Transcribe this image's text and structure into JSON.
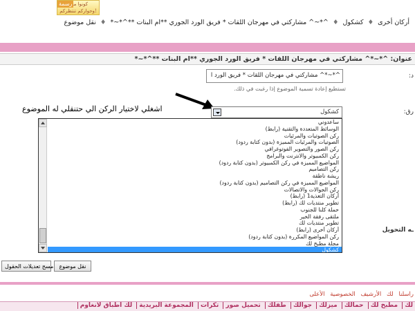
{
  "logo": {
    "badge": "رسمة",
    "line1": "كونوا معنا",
    "line2": "وحواركم تنتظركم!"
  },
  "breadcrumb": {
    "items": [
      "أركان أخرى",
      "كشكول",
      "^*~^ مشاركتي في مهرجان اللقات * فريق الورد الجوري **ام البنات **^*~*",
      "نقل موضوع"
    ],
    "separator": "♦"
  },
  "title_row": "عنوان: ^*~*^ مشاركتي في مهرجان اللقات * فريق الورد الجوري **ام البنات **^*~*",
  "title_field": {
    "label": "د:",
    "value": "^*~*^ مشاركتي  في مهرجان اللقات * فريق الورد ا",
    "hint": "تستطيع إعادة تسمية الموضوع إذا رغبت في ذلك."
  },
  "annotation_text": "اشغلي لاختيار الركن الي حتنقلي له الموضوع",
  "forum_select": {
    "label": "رق:",
    "value": "كشكول",
    "options": [
      "ساعدوني",
      "الوسائط المتعددة والتقنية (رابط)",
      "ركن الصوتيات والمرئيات",
      "الصوتيات والمرئيات المميزة (بدون كتابة ردود)",
      "ركن الصور والتصوير الفوتوغرافي",
      "ركن الكمبيوتر والانترنت والبرامج",
      "المواضيع المميزة في ركن الكمبيوتر (بدون كتابة ردود)",
      "ركن التصاميم",
      "ريشة ناطقة",
      "المواضيع المميزة في ركن التصاميم (بدون كتابة ردود)",
      "ركن الجوالات والاتصالات",
      "أركان التغذية1 (رابط)",
      "تطوير منتديات لك (رابط)",
      "حملة كلنا للجنوب",
      "ملتقى رفقة الخير",
      "تطوير منتديات لك",
      "أركان أخرى (رابط)",
      "ركن المواضيع المكررة (بدون كتابة ردود)",
      "مجلة مطبخ لك",
      "كشكول"
    ],
    "selected_index": 19
  },
  "transfer_label": "ـه التحويل",
  "buttons": {
    "move": "نقل موضوع",
    "reset": "مسح تعديلات الحقول"
  },
  "footer": {
    "links": [
      "راسلنا",
      "لك",
      "الأرشيف",
      "الخصوصية",
      "الأعلى"
    ]
  },
  "nav_bar": [
    "لك",
    "مطبخ لك",
    "حمالك",
    "ميزلك",
    "جوالك",
    "طفلك",
    "تحميل صور",
    "تكرات",
    "المجموعة البريدية",
    "لك أطباق لانغاوم"
  ]
}
